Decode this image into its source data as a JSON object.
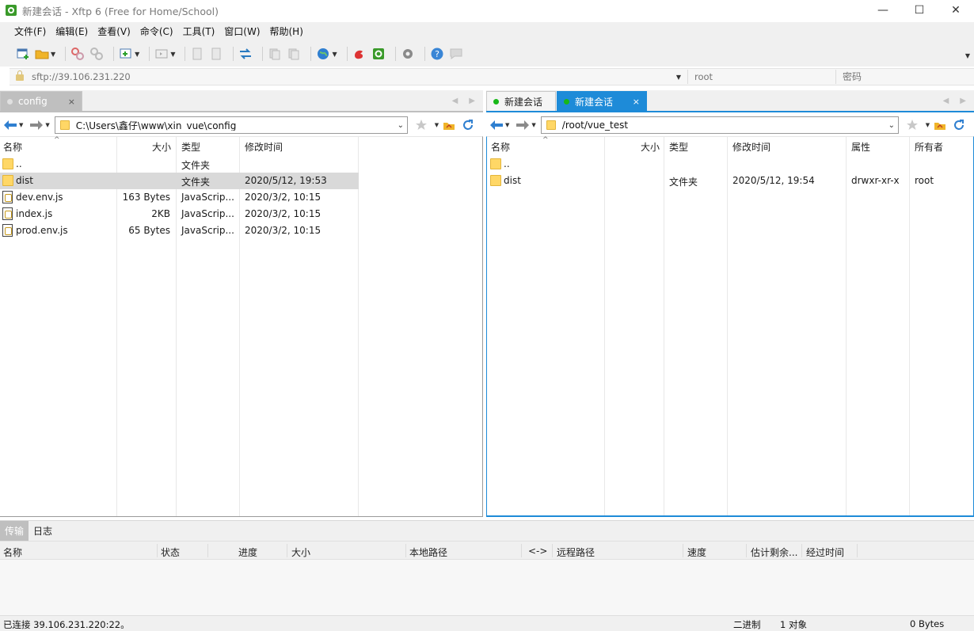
{
  "window": {
    "title": "新建会话 - Xftp 6 (Free for Home/School)",
    "controls": {
      "minimize": "—",
      "maximize": "☐",
      "close": "✕"
    }
  },
  "menu": [
    "文件(F)",
    "编辑(E)",
    "查看(V)",
    "命令(C)",
    "工具(T)",
    "窗口(W)",
    "帮助(H)"
  ],
  "address": {
    "host_placeholder": "sftp://39.106.231.220",
    "user_placeholder": "root",
    "password_placeholder": "密码"
  },
  "left_pane": {
    "tab": {
      "label": "config",
      "close": "×"
    },
    "path": "C:\\Users\\鑫仔\\www\\xin_vue\\config",
    "columns": [
      "名称",
      "大小",
      "类型",
      "修改时间"
    ],
    "rows": [
      {
        "name": "..",
        "size": "",
        "type": "文件夹",
        "mtime": "",
        "icon": "folder-icon"
      },
      {
        "name": "dist",
        "size": "",
        "type": "文件夹",
        "mtime": "2020/5/12, 19:53",
        "icon": "folder-icon",
        "selected": true
      },
      {
        "name": "dev.env.js",
        "size": "163 Bytes",
        "type": "JavaScrip...",
        "mtime": "2020/3/2, 10:15",
        "icon": "js-file-icon"
      },
      {
        "name": "index.js",
        "size": "2KB",
        "type": "JavaScrip...",
        "mtime": "2020/3/2, 10:15",
        "icon": "js-file-icon"
      },
      {
        "name": "prod.env.js",
        "size": "65 Bytes",
        "type": "JavaScrip...",
        "mtime": "2020/3/2, 10:15",
        "icon": "js-file-icon"
      }
    ]
  },
  "right_pane": {
    "tabs": [
      {
        "label": "新建会话",
        "state": "inactive"
      },
      {
        "label": "新建会话",
        "state": "active",
        "close": "×"
      }
    ],
    "path": "/root/vue_test",
    "columns": [
      "名称",
      "大小",
      "类型",
      "修改时间",
      "属性",
      "所有者"
    ],
    "rows": [
      {
        "name": "..",
        "size": "",
        "type": "",
        "mtime": "",
        "attr": "",
        "owner": "",
        "icon": "folder-icon"
      },
      {
        "name": "dist",
        "size": "",
        "type": "文件夹",
        "mtime": "2020/5/12, 19:54",
        "attr": "drwxr-xr-x",
        "owner": "root",
        "icon": "folder-icon"
      }
    ]
  },
  "transfer": {
    "tabs": [
      "传输",
      "日志"
    ],
    "columns": [
      "名称",
      "状态",
      "进度",
      "大小",
      "本地路径",
      "<->",
      "远程路径",
      "速度",
      "估计剩余...",
      "经过时间"
    ]
  },
  "status": {
    "connection": "已连接 39.106.231.220:22。",
    "mode": "二进制",
    "objects": "1 对象",
    "size": "0 Bytes"
  },
  "colors": {
    "accent": "#1e8bd8",
    "online": "#18b818",
    "selection": "#d9d9d9",
    "folder": "#ffd766"
  }
}
